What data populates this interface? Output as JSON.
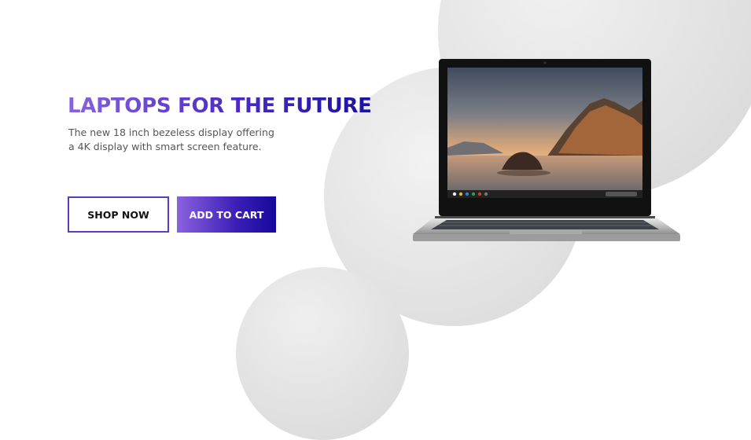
{
  "hero": {
    "title": "LAPTOPS FOR THE FUTURE",
    "description": "The new 18 inch bezeless display offering a 4K display with smart screen feature."
  },
  "buttons": {
    "shop_now": "SHOP NOW",
    "add_to_cart": "ADD TO CART"
  },
  "colors": {
    "accent_start": "#8a63df",
    "accent_end": "#1b11a0"
  },
  "product_image": "laptop"
}
